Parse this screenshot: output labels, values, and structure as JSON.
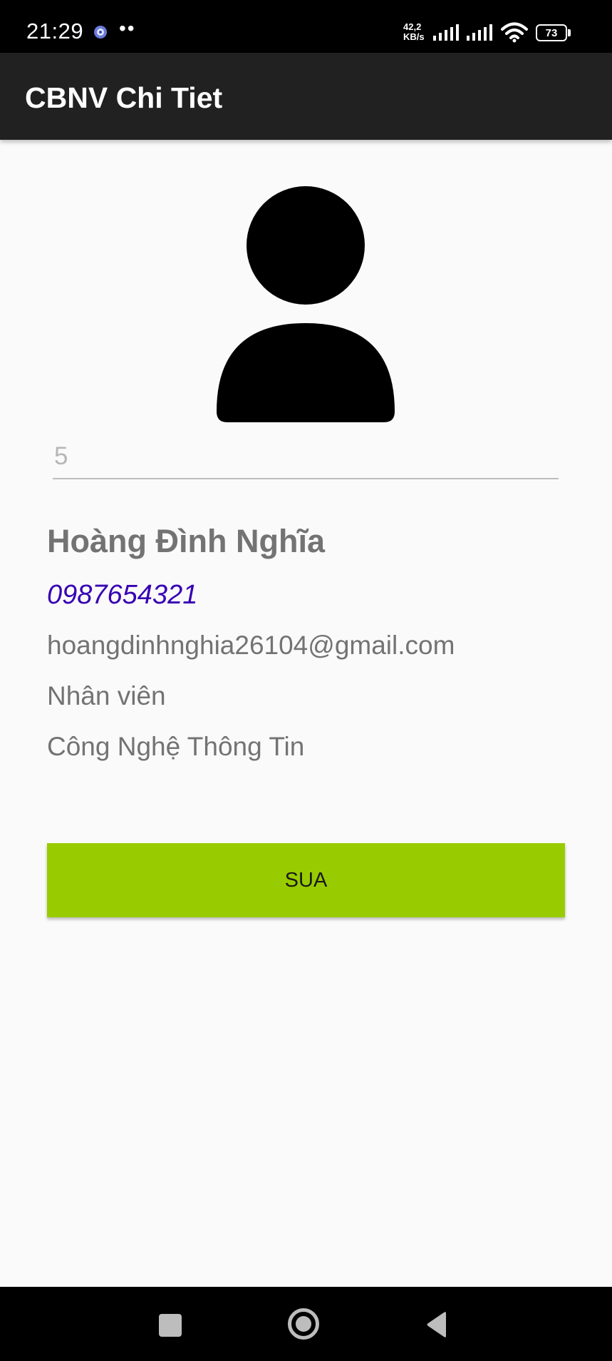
{
  "status_bar": {
    "time": "21:29",
    "notification_dots": "••",
    "net_speed_value": "42,2",
    "net_speed_unit": "KB/s",
    "battery": "73"
  },
  "app_bar": {
    "title": "CBNV Chi Tiet"
  },
  "employee": {
    "id": "5",
    "name": "Hoàng Đình Nghĩa",
    "phone": "0987654321",
    "email": "hoangdinhnghia26104@gmail.com",
    "role": "Nhân viên",
    "department": "Công Nghệ Thông Tin"
  },
  "actions": {
    "edit_label": "SUA"
  },
  "colors": {
    "app_bar": "#212121",
    "phone_text": "#3700b3",
    "button_bg": "#99cc00",
    "background": "#fafafa"
  },
  "icons": {
    "avatar": "person-icon",
    "nav_recent": "square-icon",
    "nav_home": "circle-icon",
    "nav_back": "triangle-back-icon"
  }
}
